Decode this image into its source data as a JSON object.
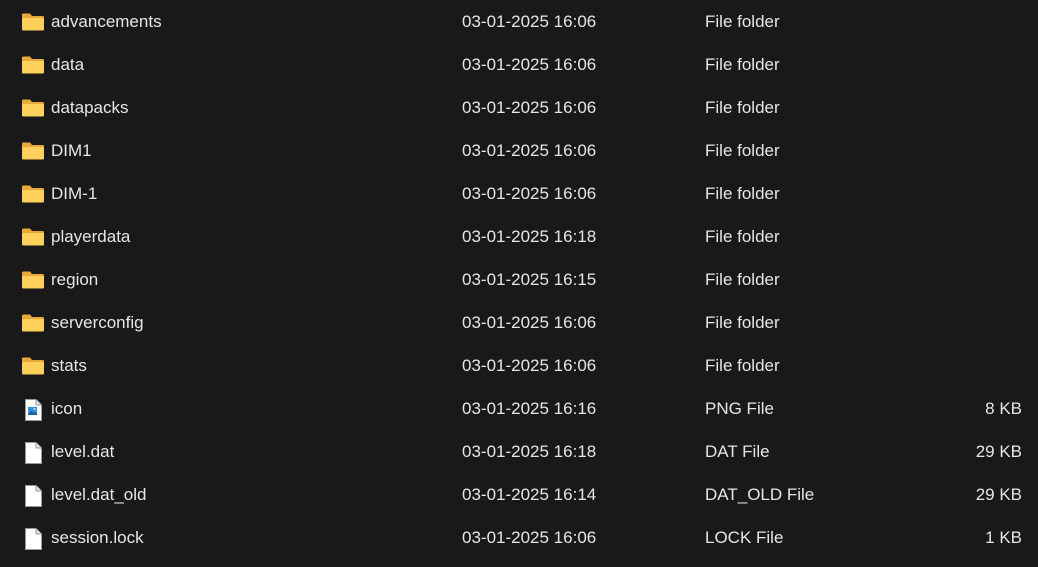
{
  "files": [
    {
      "name": "advancements",
      "modified": "03-01-2025 16:06",
      "type": "File folder",
      "size": "",
      "icon": "folder-icon"
    },
    {
      "name": "data",
      "modified": "03-01-2025 16:06",
      "type": "File folder",
      "size": "",
      "icon": "folder-icon"
    },
    {
      "name": "datapacks",
      "modified": "03-01-2025 16:06",
      "type": "File folder",
      "size": "",
      "icon": "folder-icon"
    },
    {
      "name": "DIM1",
      "modified": "03-01-2025 16:06",
      "type": "File folder",
      "size": "",
      "icon": "folder-icon"
    },
    {
      "name": "DIM-1",
      "modified": "03-01-2025 16:06",
      "type": "File folder",
      "size": "",
      "icon": "folder-icon"
    },
    {
      "name": "playerdata",
      "modified": "03-01-2025 16:18",
      "type": "File folder",
      "size": "",
      "icon": "folder-icon"
    },
    {
      "name": "region",
      "modified": "03-01-2025 16:15",
      "type": "File folder",
      "size": "",
      "icon": "folder-icon"
    },
    {
      "name": "serverconfig",
      "modified": "03-01-2025 16:06",
      "type": "File folder",
      "size": "",
      "icon": "folder-icon"
    },
    {
      "name": "stats",
      "modified": "03-01-2025 16:06",
      "type": "File folder",
      "size": "",
      "icon": "folder-icon"
    },
    {
      "name": "icon",
      "modified": "03-01-2025 16:16",
      "type": "PNG File",
      "size": "8 KB",
      "icon": "image-file-icon"
    },
    {
      "name": "level.dat",
      "modified": "03-01-2025 16:18",
      "type": "DAT File",
      "size": "29 KB",
      "icon": "file-icon"
    },
    {
      "name": "level.dat_old",
      "modified": "03-01-2025 16:14",
      "type": "DAT_OLD File",
      "size": "29 KB",
      "icon": "file-icon"
    },
    {
      "name": "session.lock",
      "modified": "03-01-2025 16:06",
      "type": "LOCK File",
      "size": "1 KB",
      "icon": "file-icon"
    }
  ],
  "colors": {
    "background": "#191919",
    "text": "#e6e6e6",
    "folder_front": "#ffd15c",
    "folder_back": "#e8a93a"
  }
}
